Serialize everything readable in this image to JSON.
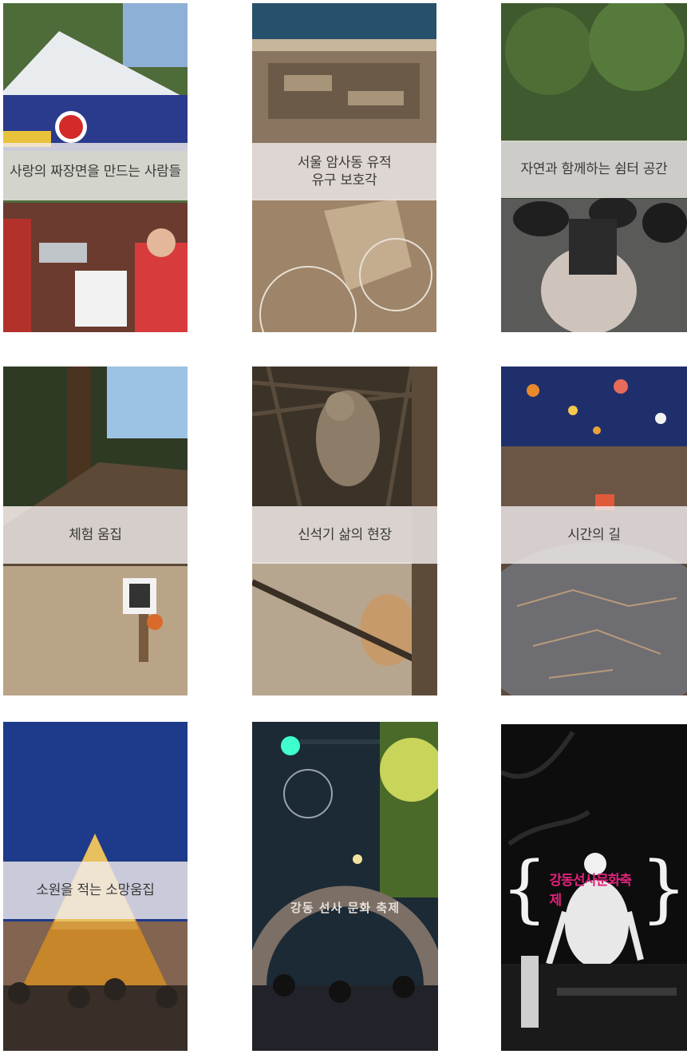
{
  "tiles": [
    {
      "caption": "사랑의 짜장면을 만드는 사람들",
      "scene": "festival-volunteer-tent"
    },
    {
      "caption": "서울 암사동 유적\n유구 보호각",
      "scene": "excavation-pit-exhibit"
    },
    {
      "caption": "자연과 함께하는 쉼터 공간",
      "scene": "forest-rest-area"
    },
    {
      "caption": "체험 움집",
      "scene": "thatched-pit-house"
    },
    {
      "caption": "신석기 삶의 현장",
      "scene": "neolithic-figure-diorama"
    },
    {
      "caption": "시간의 길",
      "scene": "mosaic-tunnel"
    },
    {
      "caption": "소원을 적는 소망움집",
      "scene": "illuminated-wish-hut"
    },
    {
      "caption": "",
      "scene": "night-gate-crowd",
      "gate_sign": "강동 선사 문화 축제"
    },
    {
      "caption": "",
      "scene": "festival-logo-dark",
      "logo_text": "강동선사문화축제",
      "brace_left": "{",
      "brace_right": "}"
    }
  ],
  "colors": {
    "caption_band": "#f0ecec",
    "caption_text": "#3a3a3a",
    "logo_accent": "#e0227c"
  }
}
